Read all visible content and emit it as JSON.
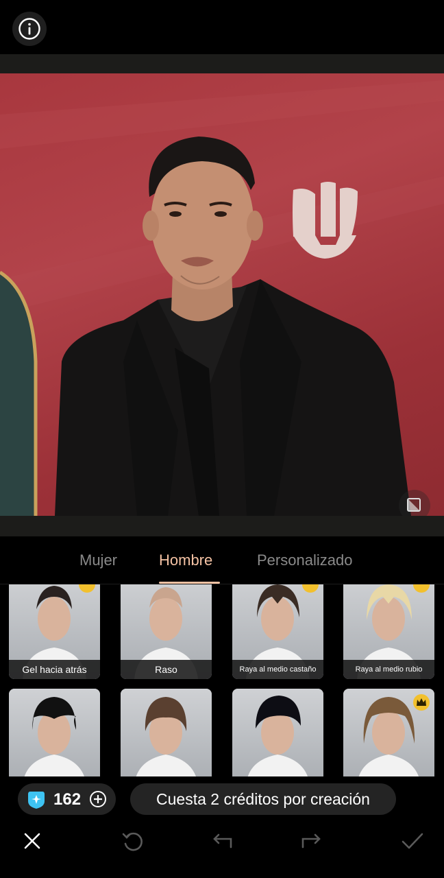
{
  "header": {
    "info_icon": "info-icon"
  },
  "tabs": [
    {
      "label": "Mujer",
      "active": false
    },
    {
      "label": "Hombre",
      "active": true
    },
    {
      "label": "Personalizado",
      "active": false
    }
  ],
  "hairstyles": [
    {
      "label": "Gel hacia atrás",
      "premium": true
    },
    {
      "label": "Raso",
      "premium": false
    },
    {
      "label": "Raya al medio castaño",
      "premium": true
    },
    {
      "label": "Raya al medio rubio",
      "premium": true
    },
    {
      "label": "",
      "premium": false
    },
    {
      "label": "",
      "premium": false
    },
    {
      "label": "",
      "premium": false
    },
    {
      "label": "",
      "premium": true
    }
  ],
  "credits": {
    "count": "162",
    "cost_text": "Cuesta 2 créditos por creación"
  },
  "toolbar": {
    "icons": [
      "close-icon",
      "reset-icon",
      "undo-icon",
      "redo-icon",
      "check-icon"
    ]
  },
  "colors": {
    "accent": "#f4c2a4",
    "crown": "#f2c02d",
    "photo_bg": "#a8373e"
  }
}
